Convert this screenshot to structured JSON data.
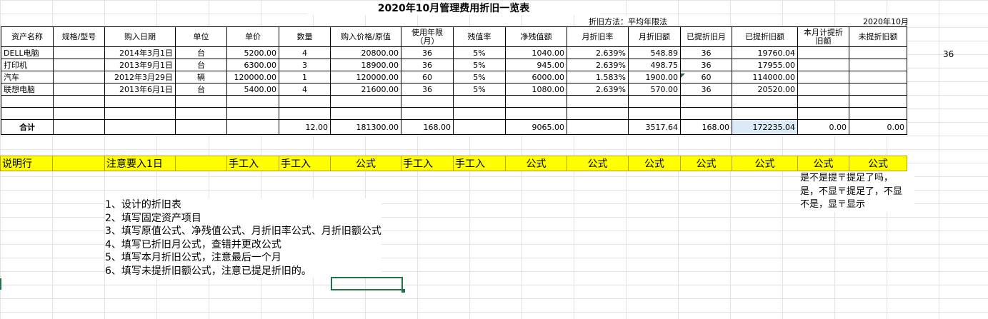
{
  "title": "2020年10月管理费用折旧一览表",
  "method_label": "折旧方法：平均年限法",
  "period": "2020年10月",
  "headers": [
    "资产名称",
    "规格/型号",
    "购入日期",
    "单位",
    "单价",
    "数量",
    "购入价格/原值",
    "使用年限（月）",
    "残值率",
    "净残值额",
    "月折旧率",
    "月折旧额",
    "已提折旧月",
    "已提折旧额",
    "本月计提折旧额",
    "未提折旧额"
  ],
  "rows": [
    [
      "DELL电脑",
      "",
      "2014年3月1日",
      "台",
      "5200.00",
      "4",
      "20800.00",
      "36",
      "5%",
      "1040.00",
      "2.639%",
      "548.89",
      "36",
      "19760.04",
      "",
      ""
    ],
    [
      "打印机",
      "",
      "2013年9月1日",
      "台",
      "6300.00",
      "3",
      "18900.00",
      "36",
      "5%",
      "945.00",
      "2.639%",
      "498.75",
      "36",
      "17955.00",
      "",
      ""
    ],
    [
      "汽车",
      "",
      "2012年3月29日",
      "辆",
      "120000.00",
      "1",
      "120000.00",
      "60",
      "5%",
      "6000.00",
      "1.583%",
      "1900.00",
      "60",
      "114000.00",
      "",
      ""
    ],
    [
      "联想电脑",
      "",
      "2013年6月1日",
      "台",
      "5400.00",
      "4",
      "21600.00",
      "36",
      "5%",
      "1080.00",
      "2.639%",
      "570.00",
      "36",
      "20520.00",
      "",
      ""
    ],
    [
      "",
      "",
      "",
      "",
      "",
      "",
      "",
      "",
      "",
      "",
      "",
      "",
      "",
      "",
      "",
      ""
    ],
    [
      "",
      "",
      "",
      "",
      "",
      "",
      "",
      "",
      "",
      "",
      "",
      "",
      "",
      "",
      "",
      ""
    ]
  ],
  "total_row": [
    "合计",
    "",
    "",
    "",
    "",
    "12.00",
    "181300.00",
    "168.00",
    "",
    "9065.00",
    "",
    "3517.64",
    "168.00",
    "172235.04",
    "0.00",
    "0.00"
  ],
  "note_row": [
    "说明行",
    "",
    "注意要入1日",
    "",
    "手工入",
    "手工入",
    "公式",
    "手工入",
    "手工入",
    "公式",
    "公式",
    "公式",
    "公式",
    "公式",
    "公式",
    "公式"
  ],
  "far_value": "36",
  "side_note": [
    "是不是提〒提足了吗，",
    "是，不显〒提足了，不显",
    "不是，显〒显示"
  ],
  "instructions": [
    "1、设计的折旧表",
    "2、填写固定资产项目",
    "3、填写原值公式、净残值公式、月折旧率公式、月折旧额公式",
    "4、填写已折旧月公式，查错并更改公式",
    "5、填写本月折旧公式，注意最后一个月",
    "6、填写未提折旧额公式，注意已提足折旧的。"
  ]
}
